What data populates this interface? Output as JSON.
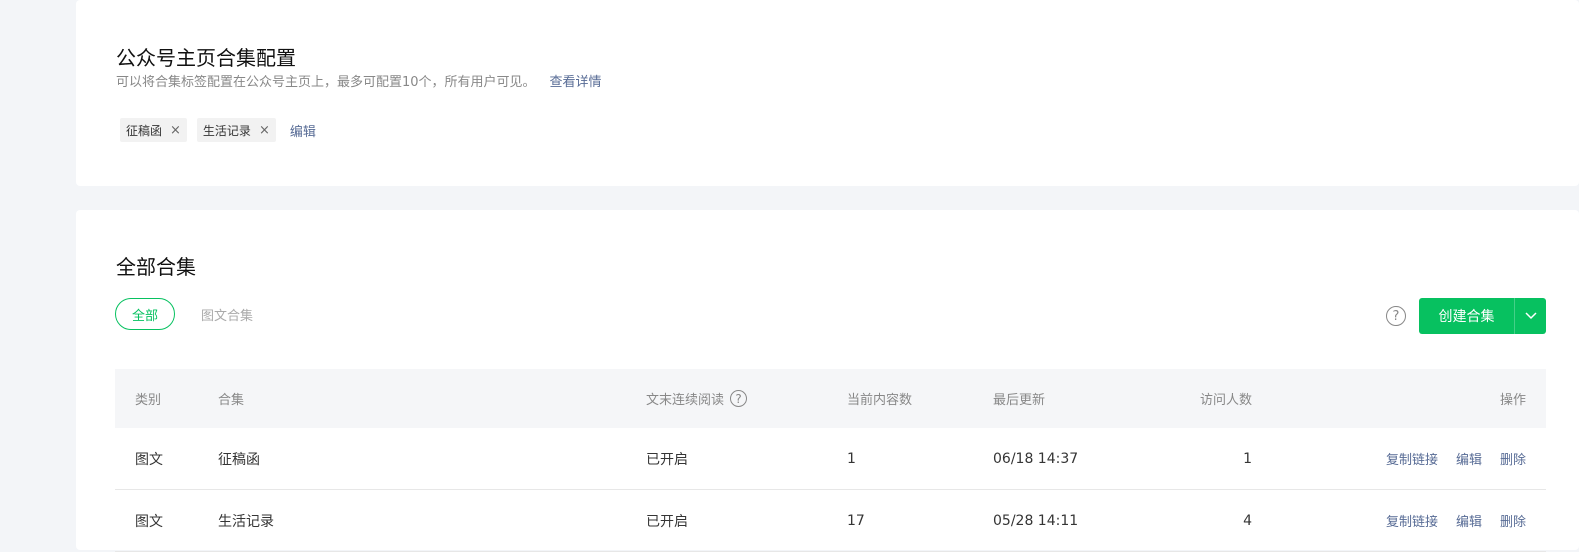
{
  "config": {
    "title": "公众号主页合集配置",
    "description": "可以将合集标签配置在公众号主页上，最多可配置10个，所有用户可见。",
    "details_link": "查看详情",
    "tags": [
      {
        "label": "征稿函",
        "close": "×"
      },
      {
        "label": "生活记录",
        "close": "×"
      }
    ],
    "edit_link": "编辑"
  },
  "collections": {
    "title": "全部合集",
    "filters": {
      "all": "全部",
      "tuwen": "图文合集"
    },
    "help_glyph": "?",
    "create_button": "创建合集",
    "table": {
      "headers": {
        "type": "类别",
        "name": "合集",
        "read": "文末连续阅读",
        "count": "当前内容数",
        "updated": "最后更新",
        "visitors": "访问人数",
        "ops": "操作"
      },
      "rows": [
        {
          "type": "图文",
          "name": "征稿函",
          "read": "已开启",
          "count": "1",
          "updated": "06/18 14:37",
          "visitors": "1",
          "copy": "复制链接",
          "edit": "编辑",
          "delete": "删除"
        },
        {
          "type": "图文",
          "name": "生活记录",
          "read": "已开启",
          "count": "17",
          "updated": "05/28 14:11",
          "visitors": "4",
          "copy": "复制链接",
          "edit": "编辑",
          "delete": "删除"
        }
      ]
    }
  },
  "colors": {
    "accent": "#07c160",
    "link": "#576b95",
    "page_bg": "#f3f5f8"
  },
  "icons": {
    "tag_close": "close-icon",
    "help": "help-icon",
    "dropdown": "chevron-down-icon"
  }
}
